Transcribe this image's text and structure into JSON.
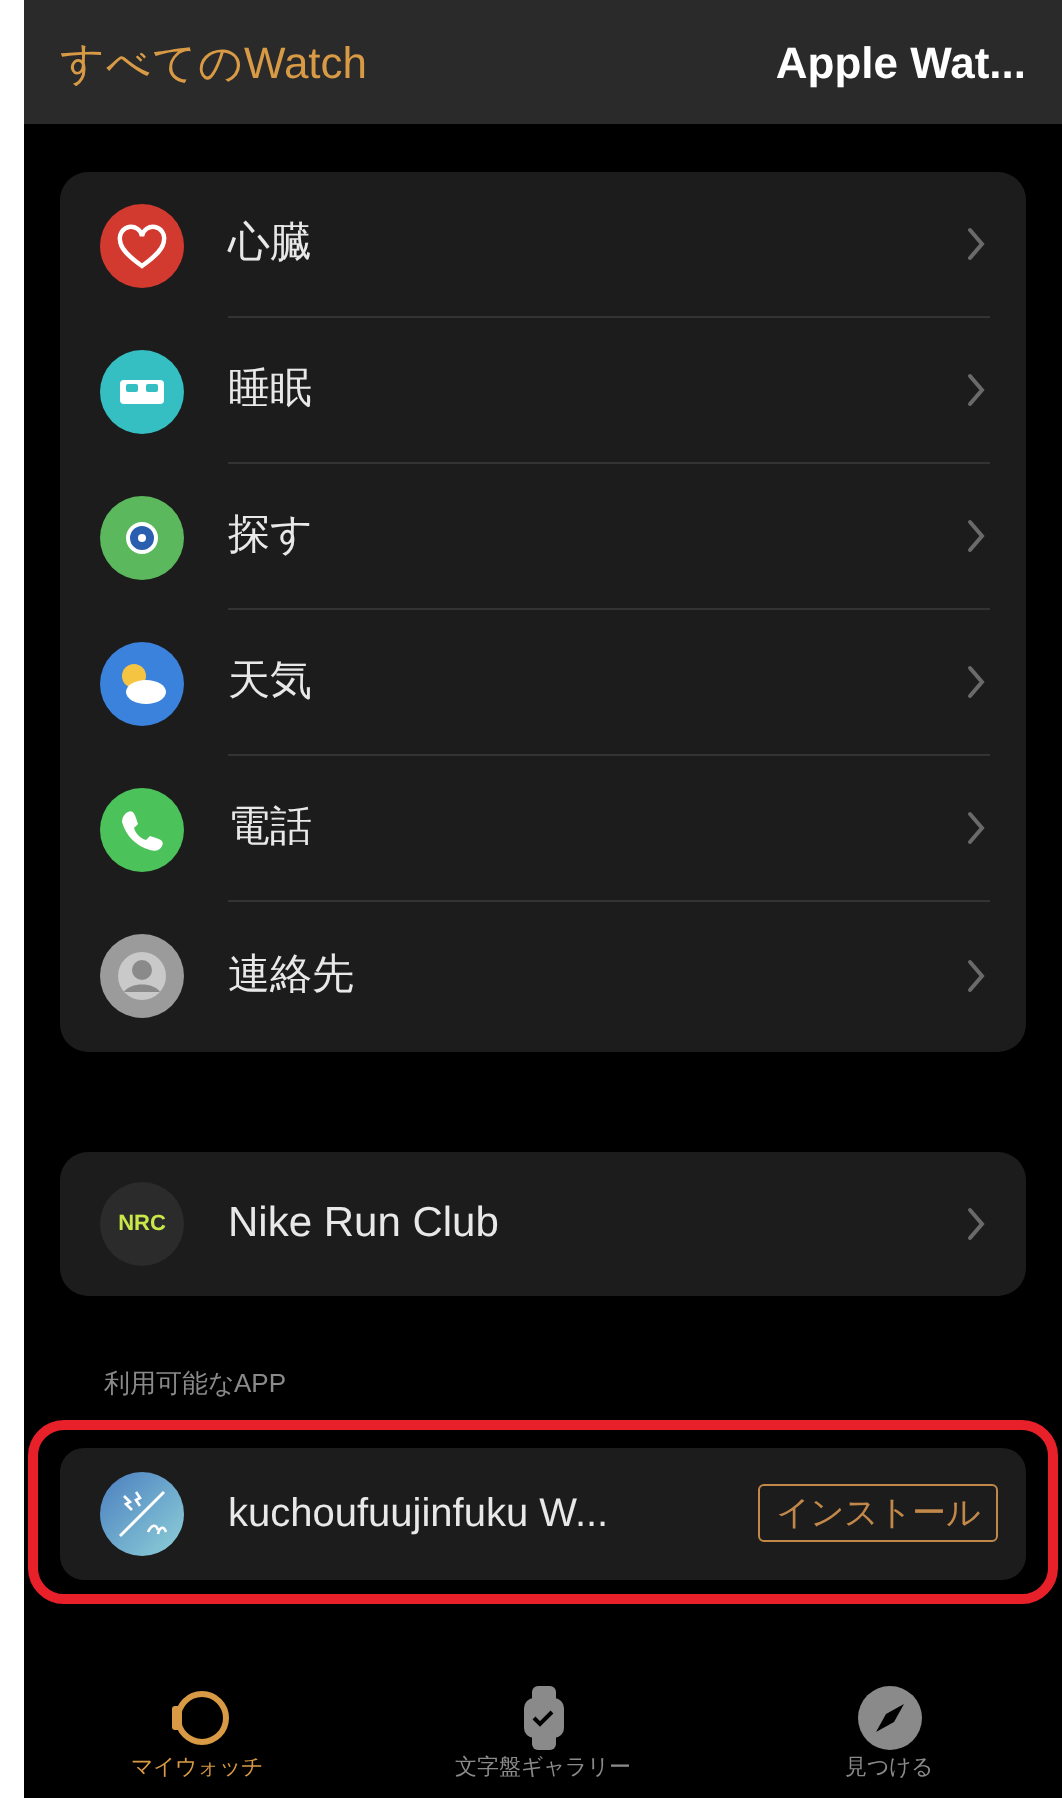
{
  "nav": {
    "back": "すべてのWatch",
    "title": "Apple Wat..."
  },
  "apps": [
    {
      "name": "心臓",
      "kind": "heart",
      "color": "#d2392f"
    },
    {
      "name": "睡眠",
      "kind": "bed",
      "color": "#35bfc2"
    },
    {
      "name": "探す",
      "kind": "find",
      "color": "#5cb85c"
    },
    {
      "name": "天気",
      "kind": "weather",
      "color": "#3b82dc"
    },
    {
      "name": "電話",
      "kind": "phone",
      "color": "#4cc35a"
    },
    {
      "name": "連絡先",
      "kind": "contact",
      "color": "#9b9b9b"
    }
  ],
  "third_party": [
    {
      "name": "Nike Run Club",
      "logo": "NRC"
    }
  ],
  "available": {
    "header": "利用可能なAPP",
    "items": [
      {
        "name": "kuchoufuujinfuku W...",
        "button": "インストール",
        "highlighted": true
      }
    ]
  },
  "tabs": [
    {
      "label": "マイウォッチ",
      "kind": "watch",
      "selected": true
    },
    {
      "label": "文字盤ギャラリー",
      "kind": "face",
      "selected": false
    },
    {
      "label": "見つける",
      "kind": "compass",
      "selected": false
    }
  ]
}
